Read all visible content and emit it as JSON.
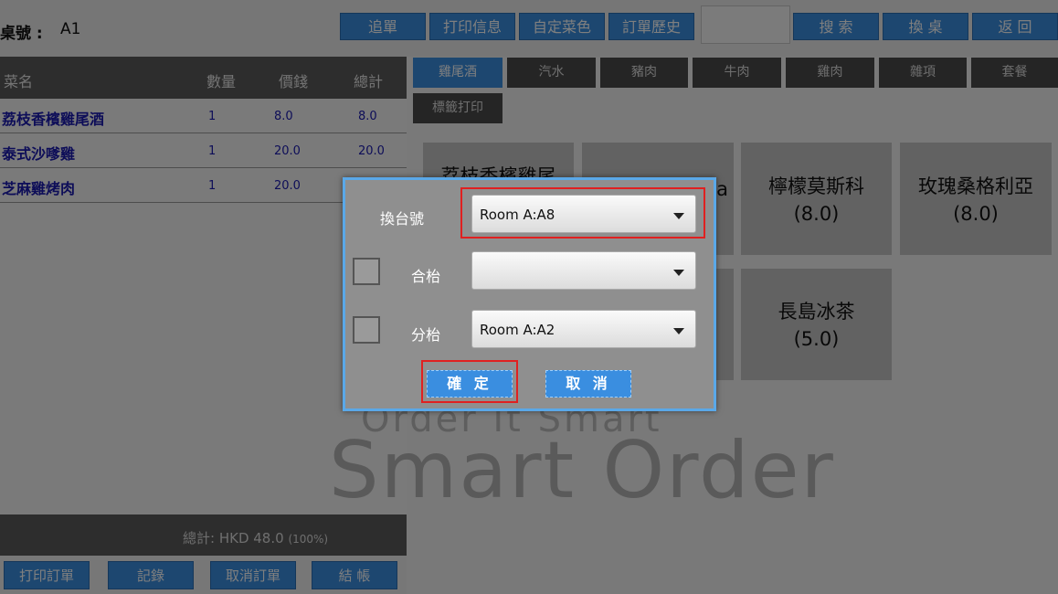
{
  "header": {
    "table_label": "桌號 :",
    "table_value": "A1",
    "buttons": [
      "追單",
      "打印信息",
      "自定菜色",
      "訂單歷史",
      "搜 索",
      "換 桌",
      "返 回"
    ]
  },
  "order": {
    "columns": [
      "菜名",
      "數量",
      "價錢",
      "總計"
    ],
    "rows": [
      {
        "name": "荔枝香檳雞尾酒",
        "qty": "1",
        "price": "8.0",
        "total": "8.0"
      },
      {
        "name": "泰式沙嗲雞",
        "qty": "1",
        "price": "20.0",
        "total": "20.0"
      },
      {
        "name": "芝麻雞烤肉",
        "qty": "1",
        "price": "20.0",
        "total": ""
      }
    ],
    "total_text": "總計: HKD 48.0",
    "total_pct": "(100%)",
    "bottom_buttons": [
      "打印訂單",
      "記錄",
      "取消訂單",
      "結 帳"
    ]
  },
  "categories": [
    "雞尾酒",
    "汽水",
    "豬肉",
    "牛肉",
    "雞肉",
    "雜項",
    "套餐",
    "標籤打印"
  ],
  "items": [
    {
      "name": "荔枝香檳雞尾",
      "price": ""
    },
    {
      "name": "a",
      "price": ""
    },
    {
      "name": "檸檬莫斯科",
      "price": "(8.0)"
    },
    {
      "name": "玫瑰桑格利亞",
      "price": "(8.0)"
    },
    {
      "name": "長島冰茶",
      "price": "(5.0)"
    }
  ],
  "watermark": {
    "line1": "Order It Smart",
    "line2": "Smart Order"
  },
  "dialog": {
    "change_label": "換台號",
    "change_value": "Room A:A8",
    "merge_label": "合枱",
    "merge_value": "",
    "split_label": "分枱",
    "split_value": "Room A:A2",
    "confirm_label": "確 定",
    "cancel_label": "取 消"
  },
  "colors": {
    "accent": "#3a8ee0",
    "highlight": "#e02020",
    "dialog_border": "#5aa8e8"
  }
}
